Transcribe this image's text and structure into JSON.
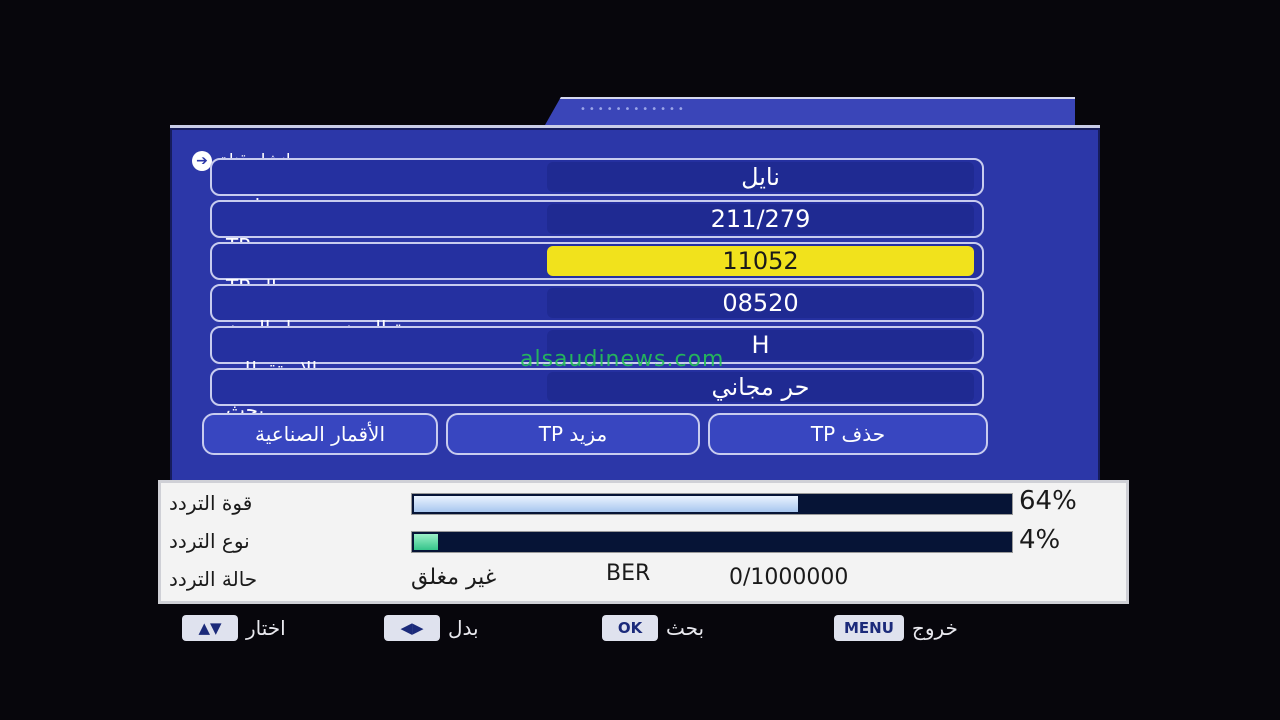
{
  "window": {
    "title": "انشاء قناة"
  },
  "rows": [
    {
      "label": "قمر صناعي",
      "value": "نايل"
    },
    {
      "label": "TP",
      "value": "211/279"
    },
    {
      "label": "تردد ال TP",
      "value": "11052"
    },
    {
      "label": "درجة الرمز  -  معدل الرمز",
      "value": "08520"
    },
    {
      "label": "الاستقطاب",
      "value": "H"
    },
    {
      "label": "بحث",
      "value": "حر     مجاني"
    }
  ],
  "buttons": {
    "satellites": "الأقمار الصناعية",
    "tp_more": "TP مزيد",
    "tp_delete": "TP حذف"
  },
  "signal": {
    "strength_label": "قوة التردد",
    "strength_value": 64,
    "strength_pct": "64%",
    "quality_label": "نوع التردد",
    "quality_value": 4,
    "quality_pct": "4%",
    "status_label": "حالة التردد",
    "lock_status": "غير مغلق",
    "ber_label": "BER",
    "ber_value": "0/1000000"
  },
  "legend": {
    "select_label": "اختار",
    "change_label": "بدل",
    "ok_key": "OK",
    "search_label": "بحث",
    "menu_key": "MENU",
    "exit_label": "خروج"
  },
  "watermark": "alsaudinews.com",
  "colors": {
    "panel": "#2c37a8",
    "active": "#f1e21c",
    "watermark": "#25c257"
  }
}
